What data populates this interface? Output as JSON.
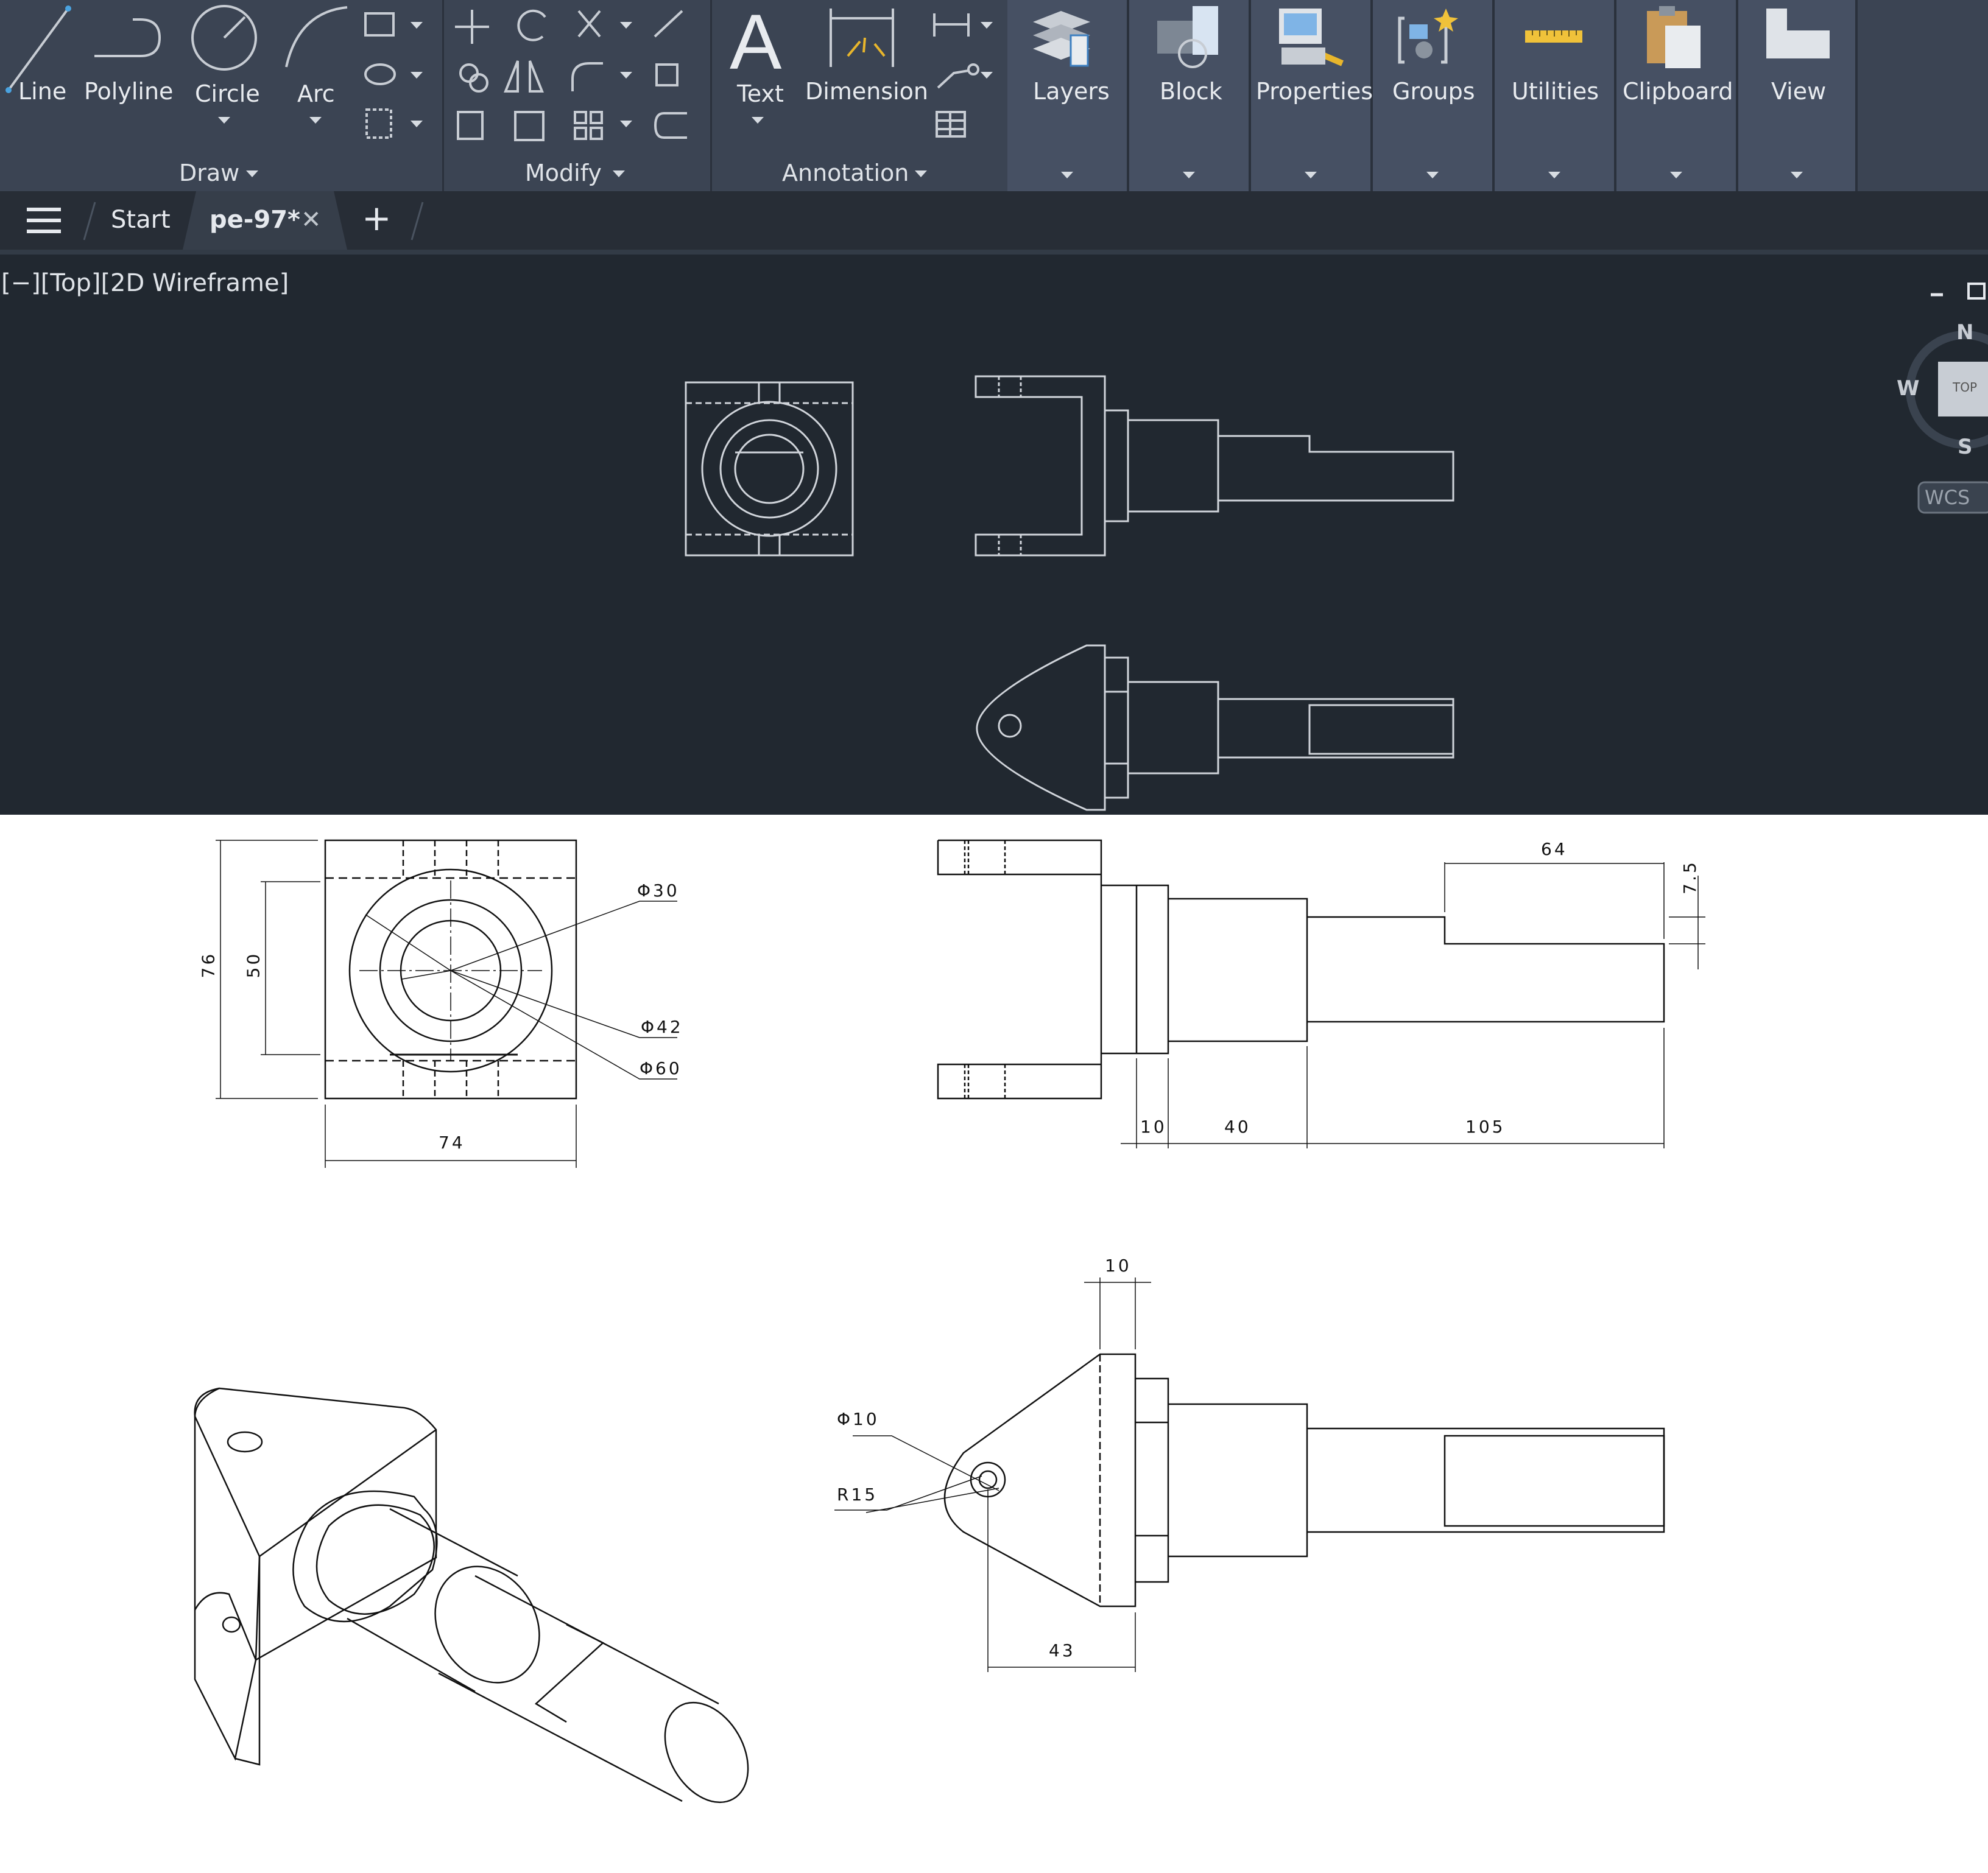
{
  "ribbon": {
    "draw_tools": [
      "Line",
      "Polyline",
      "Circle",
      "Arc"
    ],
    "annotation_tools": [
      "Text",
      "Dimension"
    ],
    "panels": [
      "Draw",
      "Modify",
      "Annotation"
    ],
    "big_panels": [
      "Layers",
      "Block",
      "Properties",
      "Groups",
      "Utilities",
      "Clipboard",
      "View"
    ]
  },
  "tabs": {
    "start": "Start",
    "active": "pe-97*",
    "close": "✕",
    "add": "+"
  },
  "viewport": {
    "label": "[−][Top][2D Wireframe]",
    "viewcube": {
      "n": "N",
      "s": "S",
      "w": "W",
      "top": "TOP",
      "wcs": "WCS"
    }
  },
  "drawing_dims": {
    "front": {
      "d30": "Φ30",
      "d42": "Φ42",
      "d60": "Φ60",
      "h76": "76",
      "h50": "50",
      "w74": "74"
    },
    "side": {
      "w64": "64",
      "h7_5": "7.5",
      "w10": "10",
      "w40": "40",
      "w105": "105"
    },
    "top": {
      "d10": "Φ10",
      "r15": "R15",
      "t10": "10",
      "w43": "43"
    }
  },
  "colors": {
    "ribbon": "#3b4453",
    "viewport": "#212830",
    "tabbar": "#272d36",
    "line_dark": "#d0d4da"
  }
}
